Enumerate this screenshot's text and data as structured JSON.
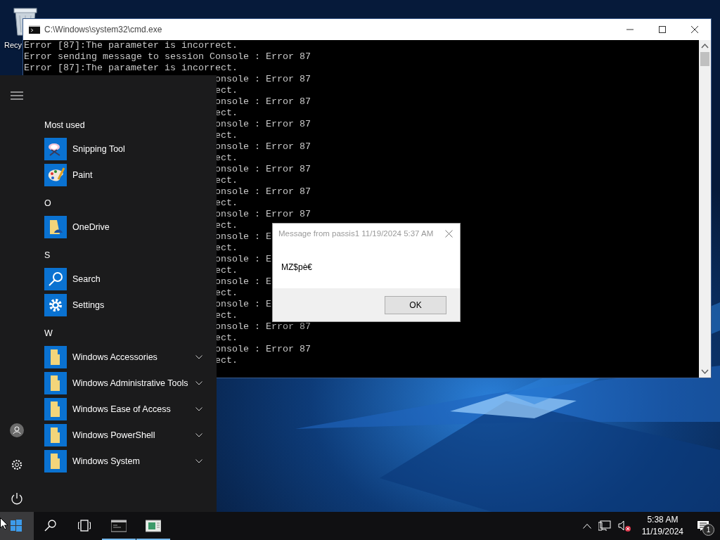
{
  "desktop": {
    "icons": [
      {
        "label": "Recy"
      }
    ]
  },
  "console_window": {
    "title": "C:\\Windows\\system32\\cmd.exe",
    "lines": [
      {
        "kind": "full",
        "text": "Error [87]:The parameter is incorrect."
      },
      {
        "kind": "full",
        "text": "Error sending message to session Console : Error 87"
      },
      {
        "kind": "full",
        "text": "Error [87]:The parameter is incorrect."
      },
      {
        "kind": "tail",
        "text": "onsole : Error 87"
      },
      {
        "kind": "tail",
        "text": "ect."
      },
      {
        "kind": "tail",
        "text": "onsole : Error 87"
      },
      {
        "kind": "tail",
        "text": "ect."
      },
      {
        "kind": "tail",
        "text": "onsole : Error 87"
      },
      {
        "kind": "tail",
        "text": "ect."
      },
      {
        "kind": "tail",
        "text": "onsole : Error 87"
      },
      {
        "kind": "tail",
        "text": "ect."
      },
      {
        "kind": "tail",
        "text": "onsole : Error 87"
      },
      {
        "kind": "tail",
        "text": "ect."
      },
      {
        "kind": "tail",
        "text": "onsole : Error 87"
      },
      {
        "kind": "tail",
        "text": "ect."
      },
      {
        "kind": "tail",
        "text": "onsole : Error 87"
      },
      {
        "kind": "tail",
        "text": "ect."
      },
      {
        "kind": "tail",
        "text": "onsole : E"
      },
      {
        "kind": "tail",
        "text": "ect."
      },
      {
        "kind": "tail",
        "text": "onsole : E"
      },
      {
        "kind": "tail",
        "text": "ect."
      },
      {
        "kind": "tail",
        "text": "onsole : E"
      },
      {
        "kind": "tail",
        "text": "ect."
      },
      {
        "kind": "tail",
        "text": "onsole : E"
      },
      {
        "kind": "tail",
        "text": "ect."
      },
      {
        "kind": "tail",
        "text": "onsole : Error 87"
      },
      {
        "kind": "tail",
        "text": "ect."
      },
      {
        "kind": "tail",
        "text": "onsole : Error 87"
      },
      {
        "kind": "tail",
        "text": "ect."
      }
    ]
  },
  "start_menu": {
    "sections": [
      {
        "heading": "Most used",
        "items": [
          {
            "label": "Snipping Tool",
            "kind": "snip"
          },
          {
            "label": "Paint",
            "kind": "paint"
          }
        ]
      },
      {
        "heading": "O",
        "items": [
          {
            "label": "OneDrive",
            "kind": "onedrive"
          }
        ]
      },
      {
        "heading": "S",
        "items": [
          {
            "label": "Search",
            "kind": "search"
          },
          {
            "label": "Settings",
            "kind": "settings"
          }
        ]
      },
      {
        "heading": "W",
        "items": [
          {
            "label": "Windows Accessories",
            "kind": "folder"
          },
          {
            "label": "Windows Administrative Tools",
            "kind": "folder"
          },
          {
            "label": "Windows Ease of Access",
            "kind": "folder"
          },
          {
            "label": "Windows PowerShell",
            "kind": "folder"
          },
          {
            "label": "Windows System",
            "kind": "folder"
          }
        ]
      }
    ]
  },
  "dialog": {
    "title": "Message from passis1 11/19/2024 5:37 AM",
    "message": "MZ$pè€",
    "button": "OK"
  },
  "taskbar": {
    "items": [
      {
        "kind": "start",
        "selected": true
      },
      {
        "kind": "search",
        "selected": false
      },
      {
        "kind": "taskview",
        "selected": false
      },
      {
        "kind": "console",
        "selected": false,
        "running": true
      },
      {
        "kind": "app",
        "selected": false,
        "running": true
      }
    ],
    "tray": {
      "volume_muted": true,
      "time": "5:38 AM",
      "date": "11/19/2024",
      "notifications": "1"
    }
  }
}
